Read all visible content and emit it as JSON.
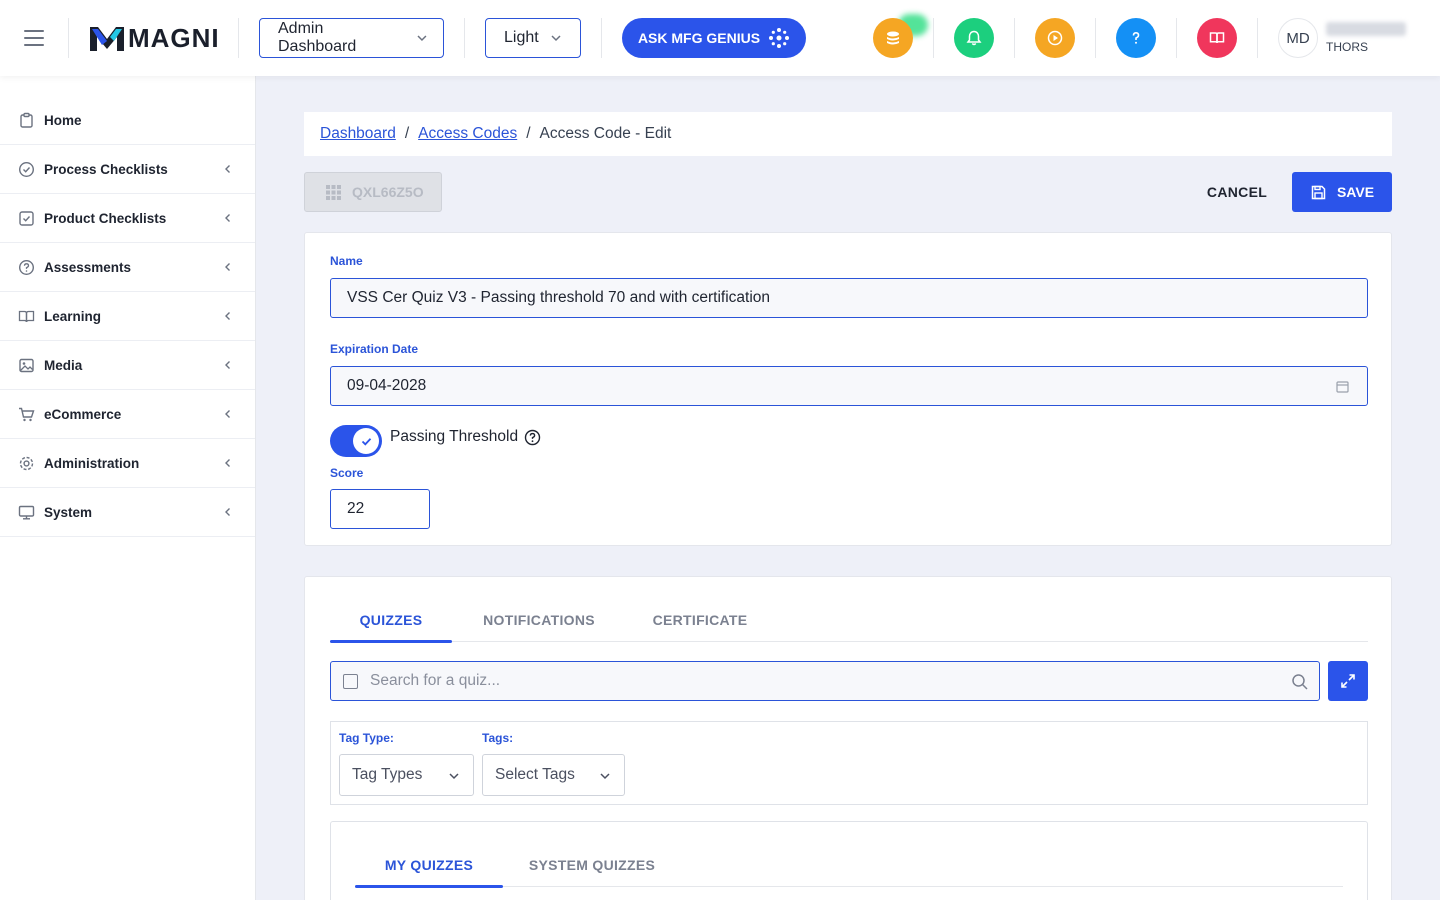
{
  "header": {
    "logo_text": "MAGNI",
    "dashboard_select": "Admin Dashboard",
    "theme_select": "Light",
    "ask_button": "ASK MFG GENIUS",
    "avatar_initials": "MD",
    "user_org": "THORS",
    "colors": {
      "coins": "#f5a623",
      "notifications": "#1ccf7e",
      "video": "#f5a623",
      "help": "#1490f5",
      "book": "#f0365c"
    }
  },
  "sidebar": {
    "items": [
      {
        "label": "Home",
        "icon": "clipboard-icon",
        "expandable": false
      },
      {
        "label": "Process Checklists",
        "icon": "check-circle-icon",
        "expandable": true
      },
      {
        "label": "Product Checklists",
        "icon": "check-square-icon",
        "expandable": true
      },
      {
        "label": "Assessments",
        "icon": "question-circle-icon",
        "expandable": true
      },
      {
        "label": "Learning",
        "icon": "book-icon",
        "expandable": true
      },
      {
        "label": "Media",
        "icon": "image-icon",
        "expandable": true
      },
      {
        "label": "eCommerce",
        "icon": "cart-icon",
        "expandable": true
      },
      {
        "label": "Administration",
        "icon": "gear-icon",
        "expandable": true
      },
      {
        "label": "System",
        "icon": "monitor-icon",
        "expandable": true
      }
    ]
  },
  "breadcrumb": {
    "items": [
      "Dashboard",
      "Access Codes",
      "Access Code - Edit"
    ]
  },
  "toolbar": {
    "code_label": "QXL66Z5O",
    "cancel_label": "CANCEL",
    "save_label": "SAVE"
  },
  "form": {
    "name_label": "Name",
    "name_value": "VSS Cer Quiz V3 - Passing threshold 70 and with certification",
    "expiration_label": "Expiration Date",
    "expiration_value": "09-04-2028",
    "passing_threshold_label": "Passing Threshold",
    "passing_threshold_enabled": true,
    "score_label": "Score",
    "score_value": "22"
  },
  "tabs": {
    "items": [
      "QUIZZES",
      "NOTIFICATIONS",
      "CERTIFICATE"
    ],
    "active": "QUIZZES"
  },
  "quiz_search": {
    "placeholder": "Search for a quiz..."
  },
  "filters": {
    "tag_type_label": "Tag Type:",
    "tag_type_value": "Tag Types",
    "tags_label": "Tags:",
    "tags_value": "Select Tags"
  },
  "subtabs": {
    "items": [
      "MY QUIZZES",
      "SYSTEM QUIZZES"
    ],
    "active": "MY QUIZZES"
  },
  "accent_color": "#2b54ea"
}
